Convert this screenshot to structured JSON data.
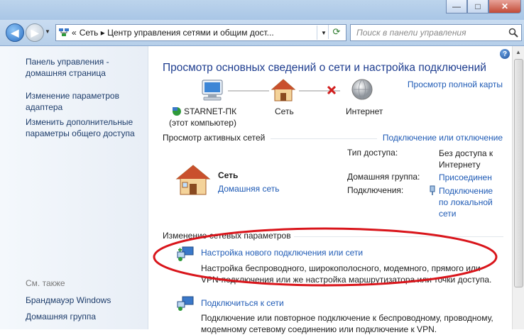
{
  "window": {
    "minimize": "—",
    "maximize": "□",
    "close": "✕"
  },
  "address_bar": {
    "path": "Сеть ▸ Центр управления сетями и общим дост...",
    "root": "«"
  },
  "search": {
    "placeholder": "Поиск в панели управления"
  },
  "sidebar": {
    "home_link": [
      "Панель управления -",
      "домашняя страница"
    ],
    "links": [
      [
        "Изменение параметров",
        "адаптера"
      ],
      [
        "Изменить дополнительные",
        "параметры общего доступа"
      ]
    ],
    "see_also_title": "См. также",
    "see_also": [
      "Брандмауэр Windows",
      "Домашняя группа"
    ]
  },
  "main": {
    "title": "Просмотр основных сведений о сети и настройка подключений",
    "full_map_link": "Просмотр полной карты",
    "map": {
      "computer_name": "STARNET-ПК",
      "computer_sub": "(этот компьютер)",
      "network_label": "Сеть",
      "internet_label": "Интернет"
    },
    "active_networks": {
      "title": "Просмотр активных сетей",
      "connect_link": "Подключение или отключение",
      "network_name": "Сеть",
      "network_type": "Домашняя сеть",
      "access_label": "Тип доступа:",
      "access_value": [
        "Без доступа к",
        "Интернету"
      ],
      "homegroup_label": "Домашняя группа:",
      "homegroup_value": "Присоединен",
      "connections_label": "Подключения:",
      "connections_value": [
        "Подключение",
        "по локальной",
        "сети"
      ]
    },
    "change_settings": {
      "title": "Изменение сетевых параметров",
      "tasks": [
        {
          "title": "Настройка нового подключения или сети",
          "desc": [
            "Настройка беспроводного, широкополосного, модемного, прямого или",
            "VPN-подключения или же настройка маршрутизатора или точки доступа."
          ]
        },
        {
          "title": "Подключиться к сети",
          "desc": [
            "Подключение или повторное подключение к беспроводному, проводному,",
            "модемному сетевому соединению или подключение к VPN."
          ]
        }
      ]
    }
  },
  "colors": {
    "link": "#1e5ab5",
    "title": "#1e3d8f",
    "annotation": "#d9151b"
  }
}
